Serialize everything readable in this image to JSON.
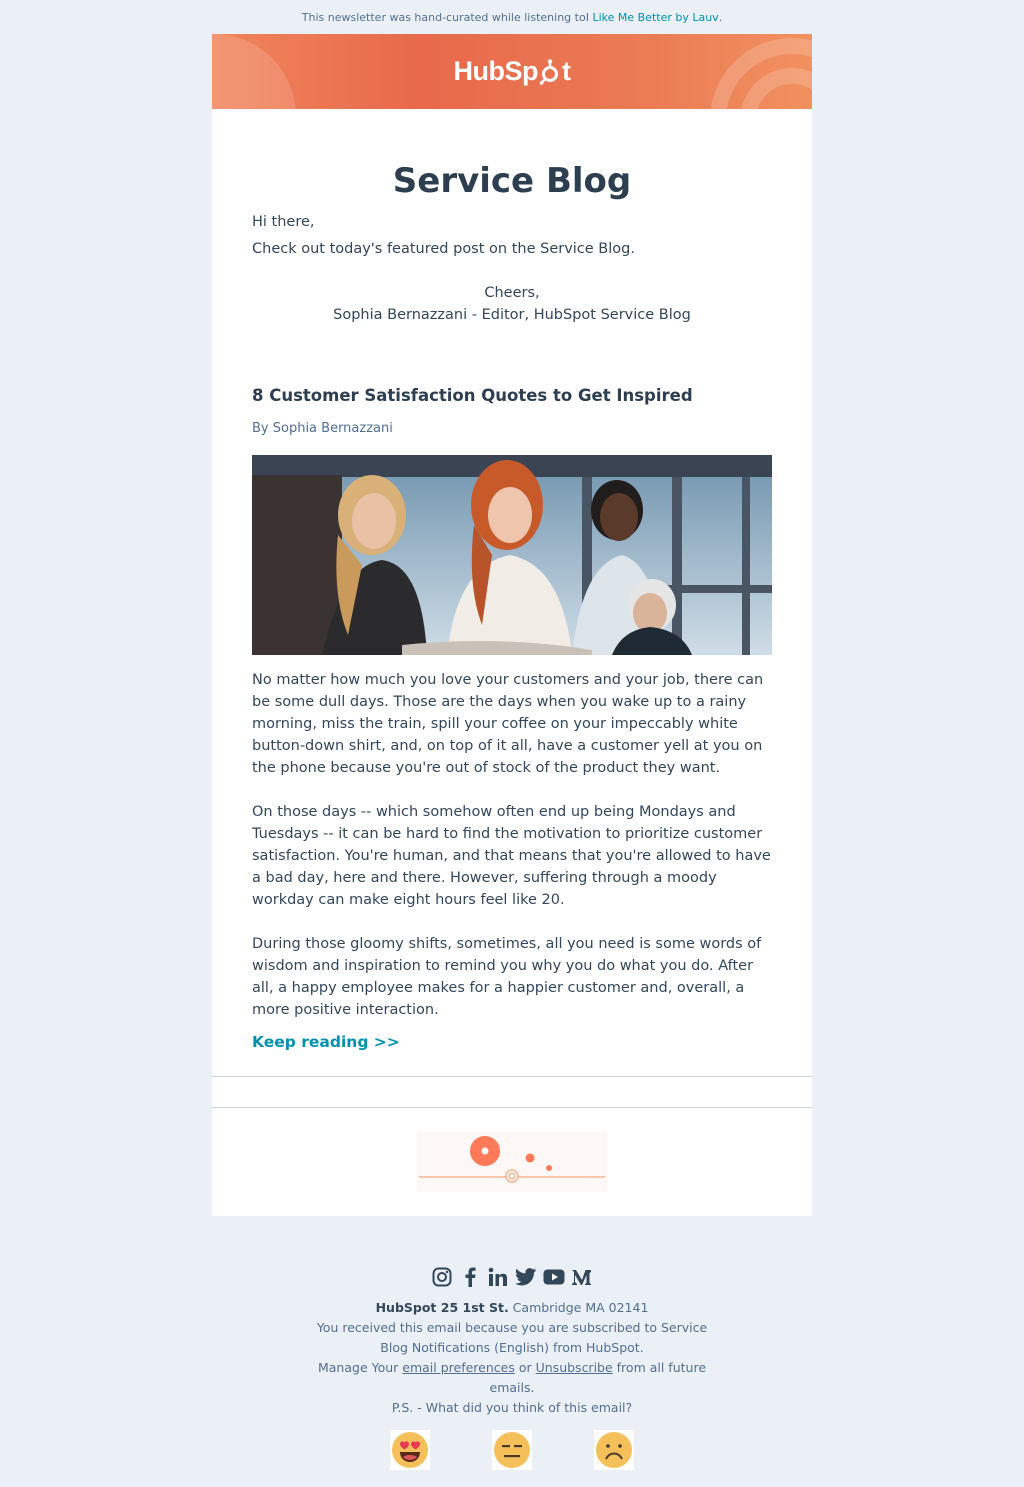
{
  "preheader": {
    "text": "This newsletter was hand-curated while listening to ",
    "link": "I Like Me Better by Lauv",
    "suffix": "."
  },
  "brand": {
    "logo_text_before": "HubSp",
    "logo_text_after": "t",
    "accent": "#ff7a59",
    "link_color": "#0091ae",
    "heading_color": "#2d3e50"
  },
  "main": {
    "blog_title": "Service Blog",
    "greeting": "Hi there,",
    "intro": "Check out today's featured post on the Service Blog.",
    "signoff": "Cheers,",
    "signature": "Sophia Bernazzani - Editor, HubSpot Service Blog"
  },
  "post": {
    "title": "8 Customer Satisfaction Quotes to Get Inspired",
    "byline": "By Sophia Bernazzani",
    "paragraphs": [
      "No matter how much you love your customers and your job, there can be some dull days. Those are the days when you wake up to a rainy morning, miss the train, spill your coffee on your impeccably white button-down shirt, and, on top of it all, have a customer yell at you on the phone because you're out of stock of the product they want.",
      "On those days -- which somehow often end up being Mondays and Tuesdays -- it can be hard to find the motivation to prioritize customer satisfaction. You're human, and that means that you're allowed to have a bad day, here and there. However, suffering through a moody workday can make eight hours feel like 20.",
      "During those gloomy shifts, sometimes, all you need is some words of wisdom and inspiration to remind you why you do what you do. After all, a happy employee makes for a happier customer and, overall, a more positive interaction."
    ],
    "cta": "Keep reading >>"
  },
  "footer": {
    "social_icons": [
      "instagram-icon",
      "facebook-icon",
      "linkedin-icon",
      "twitter-icon",
      "youtube-icon",
      "medium-icon"
    ],
    "company": "HubSpot 25 1st St.",
    "address": " Cambridge MA 02141",
    "reason": "You received this email because you are subscribed to Service Blog Notifications (English) from HubSpot.",
    "manage_prefix": "Manage Your ",
    "preferences_link": "email preferences",
    "or": " or ",
    "unsubscribe_link": "Unsubscribe",
    "manage_suffix": " from all future emails.",
    "feedback_prompt": "P.S. - What did you think of this email?",
    "feedback_options": [
      "heart-eyes-emoji",
      "neutral-face-emoji",
      "frowning-face-emoji"
    ]
  }
}
